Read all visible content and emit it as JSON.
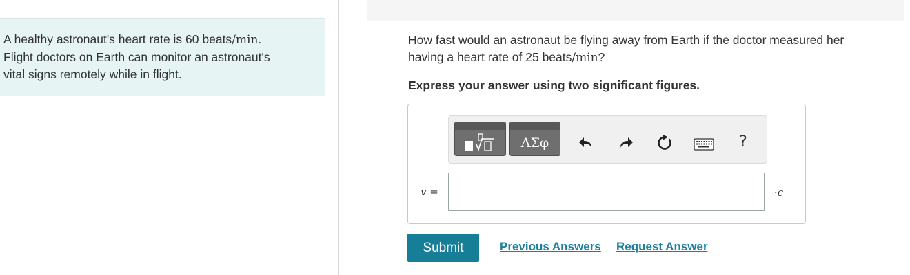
{
  "problem": {
    "intro_before": "A healthy astronaut's heart rate is 60 beats",
    "intro_unit": "/min",
    "intro_after": ".",
    "intro_line2": "Flight doctors on Earth can monitor an astronaut's",
    "intro_line3": "vital signs remotely while in flight."
  },
  "question": {
    "line1": "How fast would an astronaut be flying away from Earth if the doctor measured her",
    "line2_before": "having a heart rate of 25 beats",
    "line2_unit": "/min",
    "line2_after": "?",
    "instruction": "Express your answer using two significant figures."
  },
  "toolbar": {
    "greek_label": "ΑΣφ",
    "help_label": "?",
    "icons": [
      "templates-icon",
      "greek-letters-icon",
      "undo-icon",
      "redo-icon",
      "reset-icon",
      "keyboard-icon",
      "help-icon"
    ]
  },
  "answer": {
    "variable_label": "v =",
    "value": "",
    "unit_label": "·c"
  },
  "actions": {
    "submit_label": "Submit",
    "previous_answers_label": "Previous Answers",
    "request_answer_label": "Request Answer"
  },
  "colors": {
    "accent": "#177e98",
    "link": "#1a7fa0",
    "left_panel_bg": "#e6f4f4"
  }
}
